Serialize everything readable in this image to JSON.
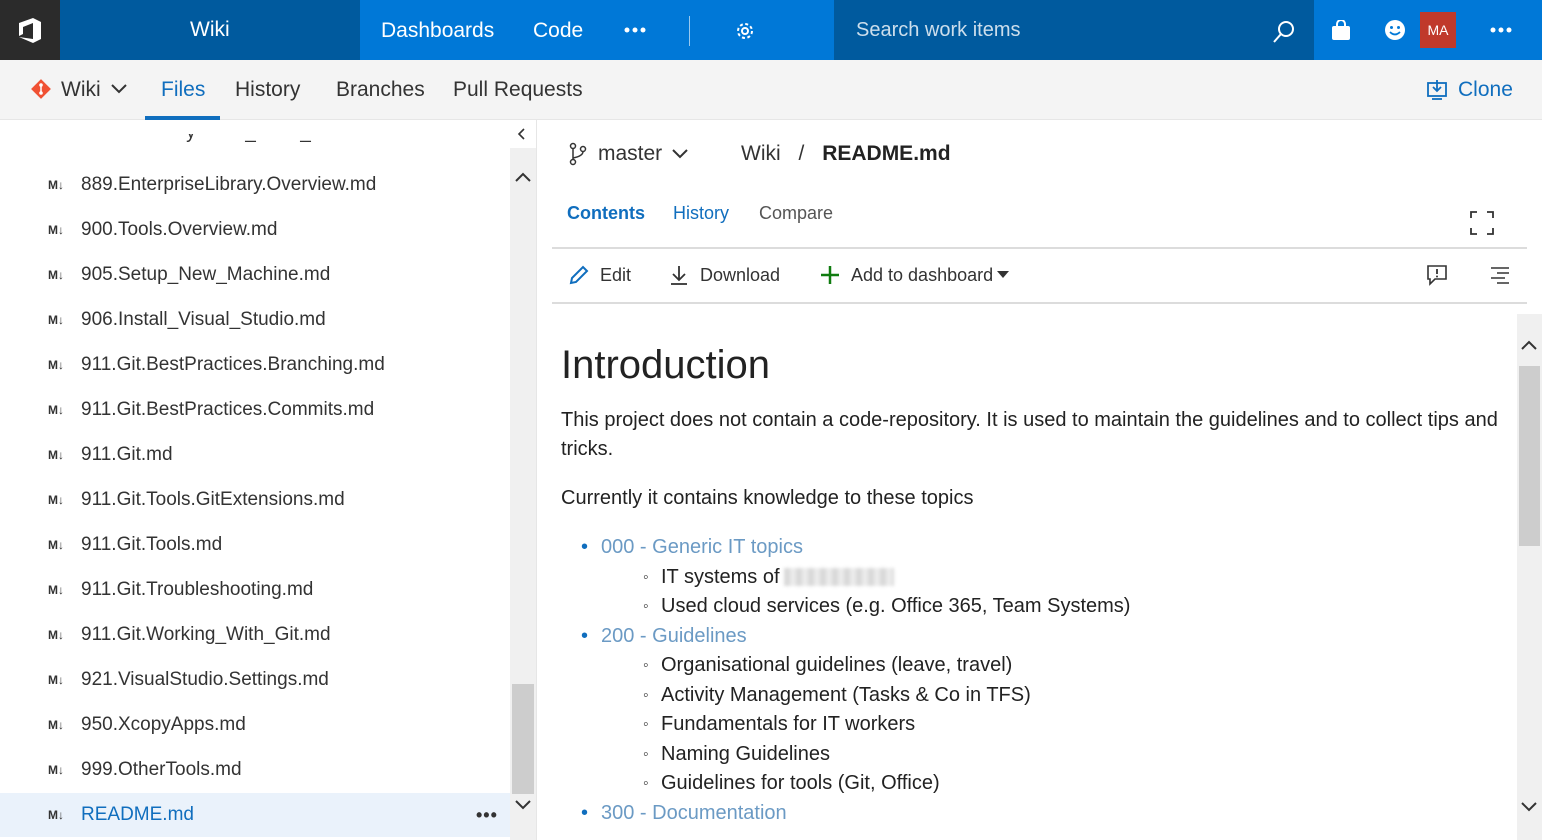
{
  "topbar": {
    "project": "Wiki",
    "nav": [
      "Dashboards",
      "Code"
    ],
    "search_placeholder": "Search work items",
    "avatar_initials": "MA",
    "colors": {
      "dark": "#005a9e",
      "accent": "#0078d7",
      "logo_bg": "#2b2b2b",
      "avatar": "#c0392b"
    }
  },
  "subnav": {
    "repo": "Wiki",
    "tabs": [
      "Files",
      "History",
      "Branches",
      "Pull Requests"
    ],
    "active_tab": "Files",
    "clone_label": "Clone"
  },
  "tree": {
    "md_badge": "M↓",
    "files": [
      "889.EnterpriseLibrary.Overview.md",
      "900.Tools.Overview.md",
      "905.Setup_New_Machine.md",
      "906.Install_Visual_Studio.md",
      "911.Git.BestPractices.Branching.md",
      "911.Git.BestPractices.Commits.md",
      "911.Git.md",
      "911.Git.Tools.GitExtensions.md",
      "911.Git.Tools.md",
      "911.Git.Troubleshooting.md",
      "911.Git.Working_With_Git.md",
      "921.VisualStudio.Settings.md",
      "950.XcopyApps.md",
      "999.OtherTools.md",
      "README.md"
    ],
    "selected": "README.md",
    "more_label": "•••"
  },
  "file_header": {
    "branch": "master",
    "path_root": "Wiki",
    "path_sep": "/",
    "path_file": "README.md"
  },
  "file_tabs": {
    "contents": "Contents",
    "history": "History",
    "compare": "Compare"
  },
  "toolbar": {
    "edit": "Edit",
    "download": "Download",
    "add_to_dashboard": "Add to dashboard"
  },
  "readme": {
    "title": "Introduction",
    "para1": "This project does not contain a code-repository. It is used to maintain the guidelines and to collect tips and tricks.",
    "para2": "Currently it contains knowledge to these topics",
    "sections": [
      {
        "label": "000 - Generic IT topics",
        "items": [
          "IT systems of",
          "Used cloud services (e.g. Office 365, Team Systems)"
        ]
      },
      {
        "label": "200 - Guidelines",
        "items": [
          "Organisational guidelines (leave, travel)",
          "Activity Management (Tasks & Co in TFS)",
          "Fundamentals for IT workers",
          "Naming Guidelines",
          "Guidelines for tools (Git, Office)"
        ]
      },
      {
        "label": "300 - Documentation",
        "items": []
      }
    ]
  }
}
